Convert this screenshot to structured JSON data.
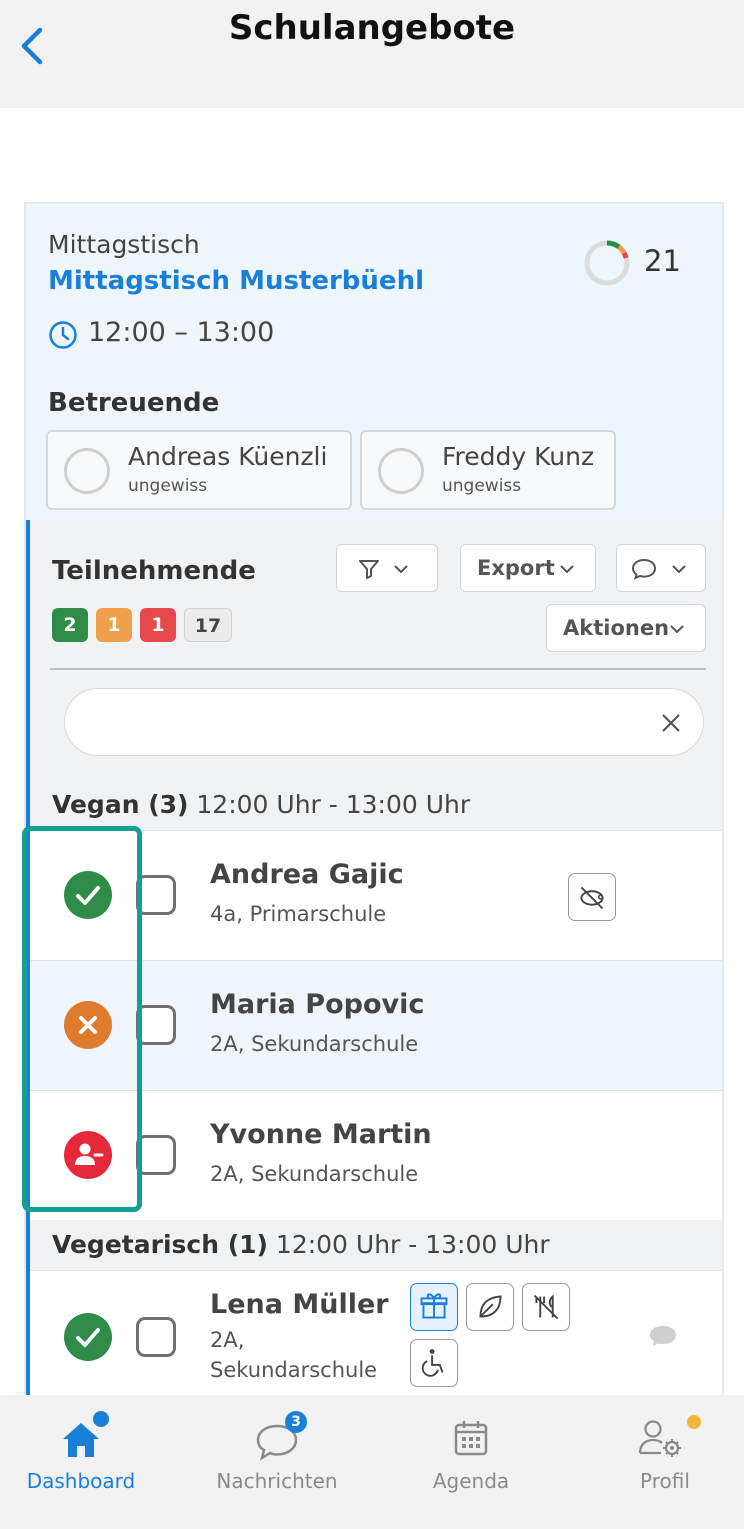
{
  "header": {
    "title": "Schulangebote",
    "back_icon": "chevron-left-icon"
  },
  "offer": {
    "category": "Mittagstisch",
    "name": "Mittagstisch Musterbüehl",
    "time": "12:00 – 13:00",
    "count": "21",
    "caregivers_heading": "Betreuende",
    "caregivers": [
      {
        "name": "Andreas Küenzli",
        "status": "ungewiss"
      },
      {
        "name": "Freddy Kunz",
        "status": "ungewiss"
      }
    ]
  },
  "participants": {
    "title": "Teilnehmende",
    "badges": [
      "2",
      "1",
      "1",
      "17"
    ],
    "buttons": {
      "export": "Export",
      "actions": "Aktionen"
    },
    "search_value": "",
    "groups": [
      {
        "label": "Vegan (3)",
        "time": " 12:00 Uhr - 13:00 Uhr",
        "rows": [
          {
            "name": "Andrea Gajic",
            "info": "4a, Primarschule",
            "status": "present"
          },
          {
            "name": "Maria Popovic",
            "info": "2A, Sekundarschule",
            "status": "absent"
          },
          {
            "name": "Yvonne Martin",
            "info": "2A, Sekundarschule",
            "status": "excused"
          }
        ]
      },
      {
        "label": "Vegetarisch (1)",
        "time": " 12:00 Uhr - 13:00 Uhr",
        "rows": [
          {
            "name": "Lena Müller",
            "info_line1": "2A,",
            "info_line2": "Sekundarschule",
            "status": "present"
          }
        ]
      }
    ]
  },
  "nav": {
    "items": [
      {
        "label": "Dashboard",
        "icon": "home-icon"
      },
      {
        "label": "Nachrichten",
        "icon": "chat-icon",
        "badge": "3"
      },
      {
        "label": "Agenda",
        "icon": "calendar-icon"
      },
      {
        "label": "Profil",
        "icon": "profile-settings-icon"
      }
    ]
  },
  "colors": {
    "accent": "#1a7fd8",
    "present": "#2e8b48",
    "absent": "#e07a2e",
    "excused": "#e5293b",
    "highlight": "#13a092"
  }
}
